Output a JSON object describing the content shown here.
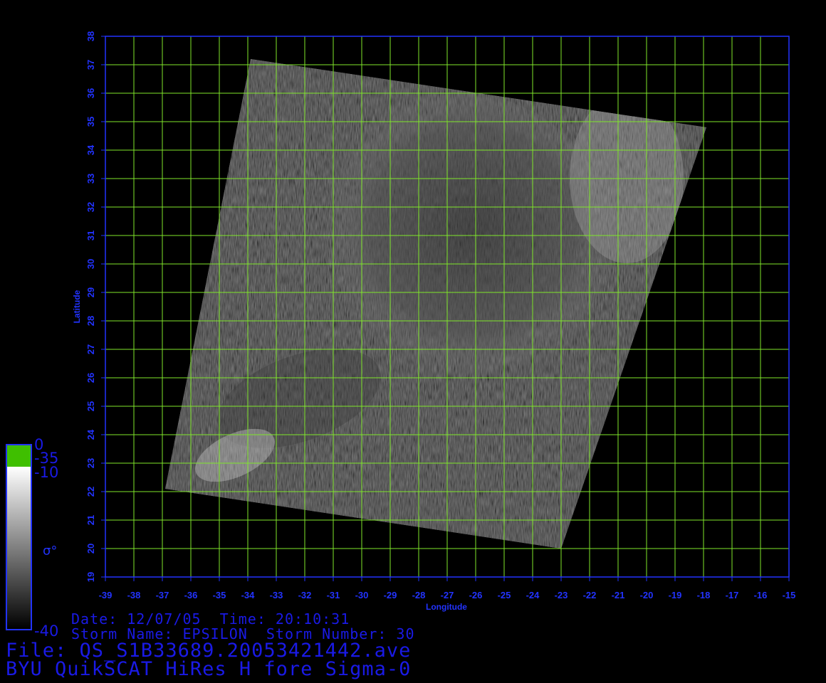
{
  "axes": {
    "xlabel": "Longitude",
    "ylabel": "Latitude",
    "x_ticks": [
      -39,
      -38,
      -37,
      -36,
      -35,
      -34,
      -33,
      -32,
      -31,
      -30,
      -29,
      -28,
      -27,
      -26,
      -25,
      -24,
      -23,
      -22,
      -21,
      -20,
      -19,
      -18,
      -17,
      -16,
      -15
    ],
    "y_ticks": [
      19,
      20,
      21,
      22,
      23,
      24,
      25,
      26,
      27,
      28,
      29,
      30,
      31,
      32,
      33,
      34,
      35,
      36,
      37,
      38
    ],
    "x_range": [
      -39,
      -15
    ],
    "y_range": [
      19,
      38
    ],
    "grid": true,
    "grid_color": "#7fe62a",
    "axis_color": "#2233ff"
  },
  "swath": {
    "corners_lonlat": [
      [
        -33.9,
        37.2
      ],
      [
        -17.9,
        34.8
      ],
      [
        -23.0,
        20.0
      ],
      [
        -36.9,
        22.1
      ]
    ],
    "description_colors": {
      "dark": "#2a2a2a",
      "light": "#a8a8a8"
    }
  },
  "colorbar": {
    "symbol": "σ°",
    "labels": [
      "0",
      "-35",
      "-10",
      "-40"
    ],
    "top_color": "#3fbf00",
    "border_color": "#2233ff"
  },
  "info": {
    "date_line": "Date: 12/07/05  Time: 20:10:31",
    "storm_line": "Storm Name: EPSILON  Storm Number: 30",
    "file_line": "File: QS_S1B33689.20053421442.ave",
    "title_line": "BYU QuikSCAT HiRes H fore Sigma-0"
  }
}
